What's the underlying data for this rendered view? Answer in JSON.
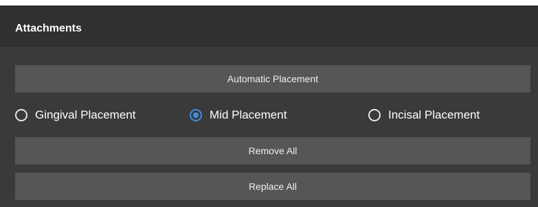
{
  "panel": {
    "title": "Attachments"
  },
  "buttons": {
    "automatic": "Automatic Placement",
    "remove_all": "Remove All",
    "replace_all": "Replace All"
  },
  "placement_options": [
    {
      "label": "Gingival Placement",
      "selected": false
    },
    {
      "label": "Mid Placement",
      "selected": true
    },
    {
      "label": "Incisal Placement",
      "selected": false
    }
  ],
  "colors": {
    "accent": "#3b8fe0",
    "panel_bg": "#3a3a3a",
    "header_bg": "#303030",
    "button_bg": "#565656"
  }
}
